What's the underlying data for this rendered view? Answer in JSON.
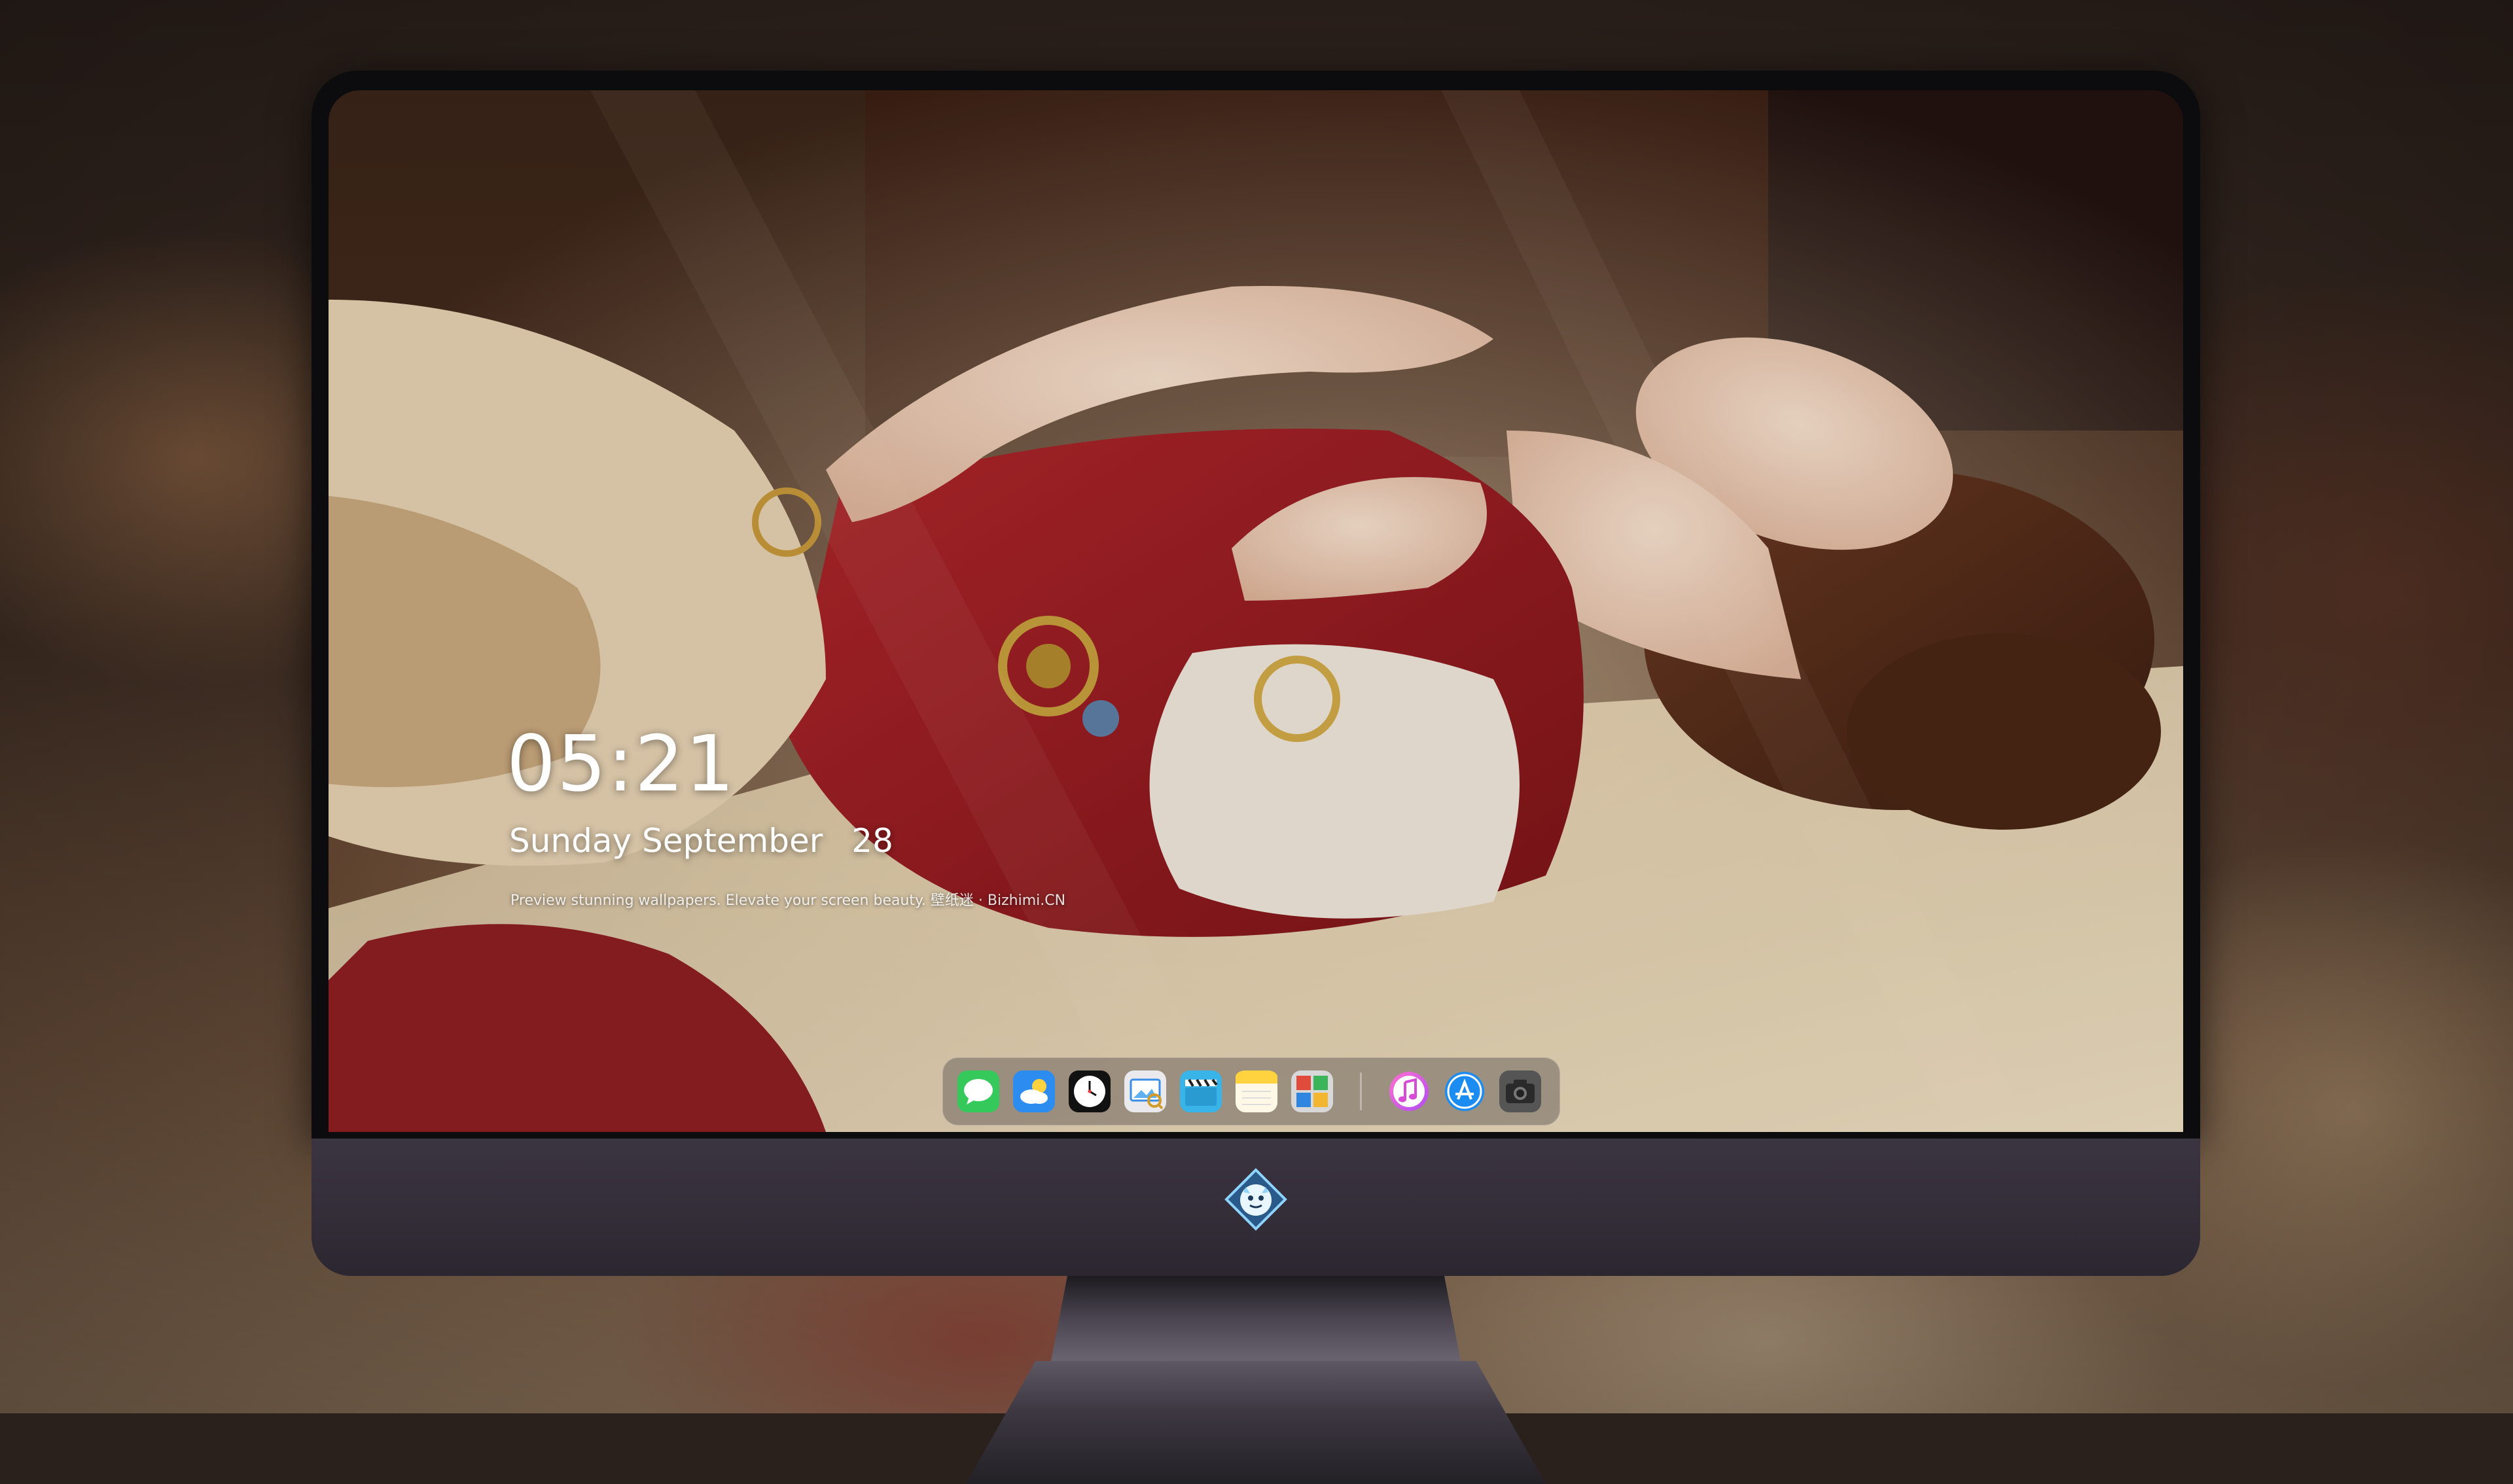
{
  "lock_screen": {
    "time": "05:21",
    "weekday": "Sunday",
    "month": "September",
    "day": "28",
    "tagline": "Preview stunning wallpapers. Elevate your screen beauty. 壁纸迷 · Bizhimi.CN"
  },
  "dock": {
    "apps": [
      {
        "name": "messages",
        "icon": "messages-icon",
        "color": "#35c85a"
      },
      {
        "name": "weather",
        "icon": "weather-icon",
        "color": "#2d8cf0"
      },
      {
        "name": "clock",
        "icon": "clock-icon",
        "color": "#111111"
      },
      {
        "name": "preview",
        "icon": "preview-icon",
        "color": "#e9e9ee"
      },
      {
        "name": "clips",
        "icon": "clapperboard-icon",
        "color": "#39b4e8"
      },
      {
        "name": "notes",
        "icon": "notes-icon",
        "color": "#ffd23f"
      },
      {
        "name": "photo-booth",
        "icon": "photo-booth-icon",
        "color": "#d8d8d8"
      },
      {
        "name": "music",
        "icon": "music-icon",
        "color": "#f25ad2"
      },
      {
        "name": "app-store",
        "icon": "app-store-icon",
        "color": "#1b8cf2"
      },
      {
        "name": "camera",
        "icon": "camera-icon",
        "color": "#555555"
      }
    ]
  },
  "monitor": {
    "logo": "dragon-mascot-logo-icon"
  }
}
